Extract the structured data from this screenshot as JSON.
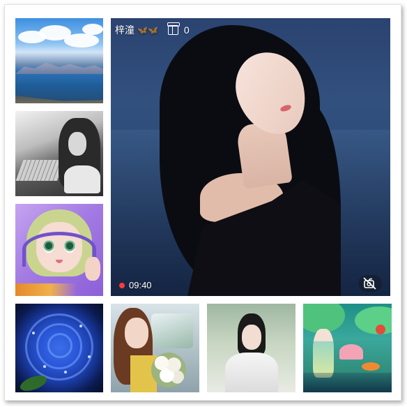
{
  "main_stream": {
    "streamer_name": "梓潼",
    "name_badge": "🦋🦋",
    "gift_count": "0",
    "duration": "09:40",
    "icons": {
      "gift": "gift-icon",
      "recording": "recording-dot-icon",
      "camera_off": "camera-off-icon"
    }
  },
  "thumbnails": [
    {
      "name": "sea-landscape-thumbnail"
    },
    {
      "name": "grayscale-girl-thumbnail"
    },
    {
      "name": "anime-avatar-thumbnail"
    },
    {
      "name": "blue-rose-thumbnail"
    },
    {
      "name": "girl-in-car-thumbnail"
    },
    {
      "name": "white-robe-man-thumbnail"
    },
    {
      "name": "fairy-lotus-thumbnail"
    }
  ],
  "colors": {
    "recording_dot": "#ff3b3b",
    "frame_background": "#ffffff",
    "text": "#ffffff"
  }
}
